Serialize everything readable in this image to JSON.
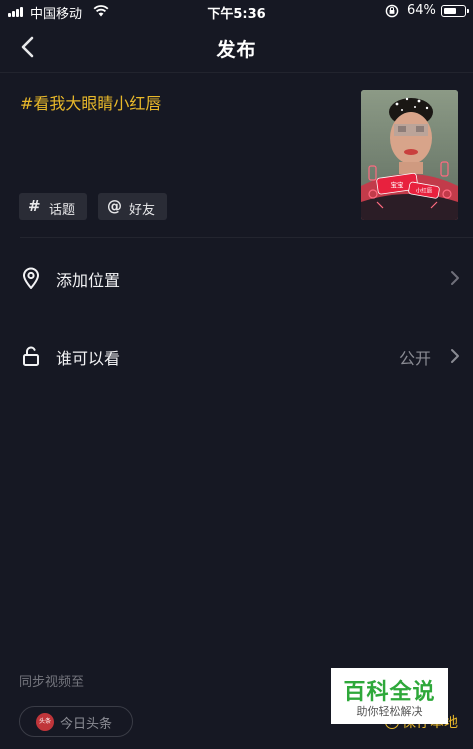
{
  "status_bar": {
    "carrier": "中国移动",
    "time": "下午5:36",
    "battery_percent": "64%",
    "battery_level": 0.64,
    "icons": [
      "signal-icon",
      "wifi-icon",
      "rotation-lock-icon",
      "battery-icon"
    ]
  },
  "nav": {
    "title": "发布",
    "back_icon": "chevron-left-icon"
  },
  "post": {
    "caption": "#看我大眼睛小红唇",
    "chips": [
      {
        "glyph": "#",
        "label": "话题",
        "icon": "hashtag-icon"
      },
      {
        "glyph": "@",
        "label": "好友",
        "icon": "at-icon"
      }
    ],
    "thumbnail_stickers": [
      "宝宝",
      "小红唇"
    ]
  },
  "options": {
    "location": {
      "label": "添加位置",
      "icon": "location-pin-icon"
    },
    "privacy": {
      "label": "谁可以看",
      "value": "公开",
      "icon": "unlock-icon"
    }
  },
  "sync": {
    "label": "同步视频至",
    "target": "今日头条",
    "target_logo_text": "头条"
  },
  "save_local": {
    "label": "保存本地",
    "icon": "check-circle-icon"
  },
  "watermark": {
    "title": "百科全说",
    "subtitle": "助你轻松解决"
  },
  "colors": {
    "background": "#161823",
    "accent": "#e8b82a",
    "chip_bg": "#2a2c36",
    "secondary_text": "#8a8b93"
  }
}
